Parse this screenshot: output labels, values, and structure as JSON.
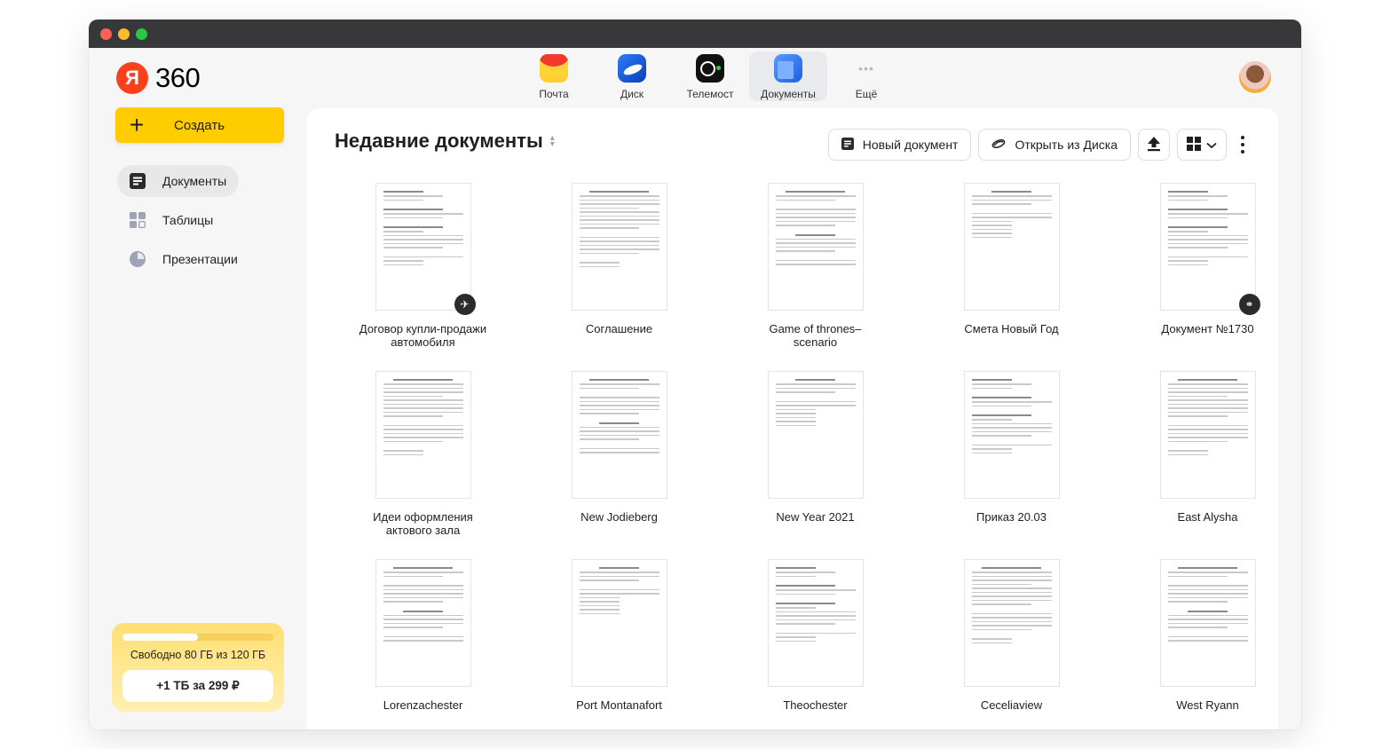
{
  "logo": {
    "mark": "Я",
    "text": "360"
  },
  "services": [
    {
      "label": "Почта",
      "icon": "mail-icon",
      "active": false
    },
    {
      "label": "Диск",
      "icon": "disk-icon",
      "active": false
    },
    {
      "label": "Телемост",
      "icon": "telemost-icon",
      "active": false
    },
    {
      "label": "Документы",
      "icon": "documents-icon",
      "active": true
    },
    {
      "label": "Ещё",
      "icon": "more-icon",
      "glyph": "•••",
      "active": false
    }
  ],
  "create_button": {
    "icon": "+",
    "label": "Создать"
  },
  "sidebar": {
    "items": [
      {
        "label": "Документы",
        "icon": "document-icon",
        "active": true
      },
      {
        "label": "Таблицы",
        "icon": "spreadsheet-icon",
        "active": false
      },
      {
        "label": "Презентации",
        "icon": "presentation-icon",
        "active": false
      }
    ]
  },
  "storage": {
    "text": "Свободно 80 ГБ из 120 ГБ",
    "used_fraction": 0.5,
    "buy_label": "+1 ТБ за 299 ₽"
  },
  "main": {
    "title": "Недавние документы",
    "toolbar": {
      "new_doc": "Новый документ",
      "open_disk": "Открыть из Диска",
      "upload_icon": "upload-icon",
      "view_icon": "grid-view-icon",
      "more_icon": "more-vertical-icon"
    },
    "documents": [
      {
        "title": "Договор купли-продажи автомобиля",
        "badge": "pin-icon"
      },
      {
        "title": "Соглашение",
        "badge": null
      },
      {
        "title": "Game of thrones–scenario",
        "badge": null
      },
      {
        "title": "Смета Новый Год",
        "badge": null
      },
      {
        "title": "Документ №1730",
        "badge": "link-icon"
      },
      {
        "title": "Идеи оформления актового зала",
        "badge": null
      },
      {
        "title": "New Jodieberg",
        "badge": null
      },
      {
        "title": "New Year 2021",
        "badge": null
      },
      {
        "title": "Приказ 20.03",
        "badge": null
      },
      {
        "title": "East Alysha",
        "badge": null
      },
      {
        "title": "Lorenzachester",
        "badge": null
      },
      {
        "title": "Port Montanafort",
        "badge": null
      },
      {
        "title": "Theochester",
        "badge": null
      },
      {
        "title": "Ceceliaview",
        "badge": null
      },
      {
        "title": "West Ryann",
        "badge": null
      }
    ]
  },
  "colors": {
    "accent_yellow": "#ffcc00",
    "logo_red": "#fc3f1d",
    "titlebar": "#37383a"
  }
}
